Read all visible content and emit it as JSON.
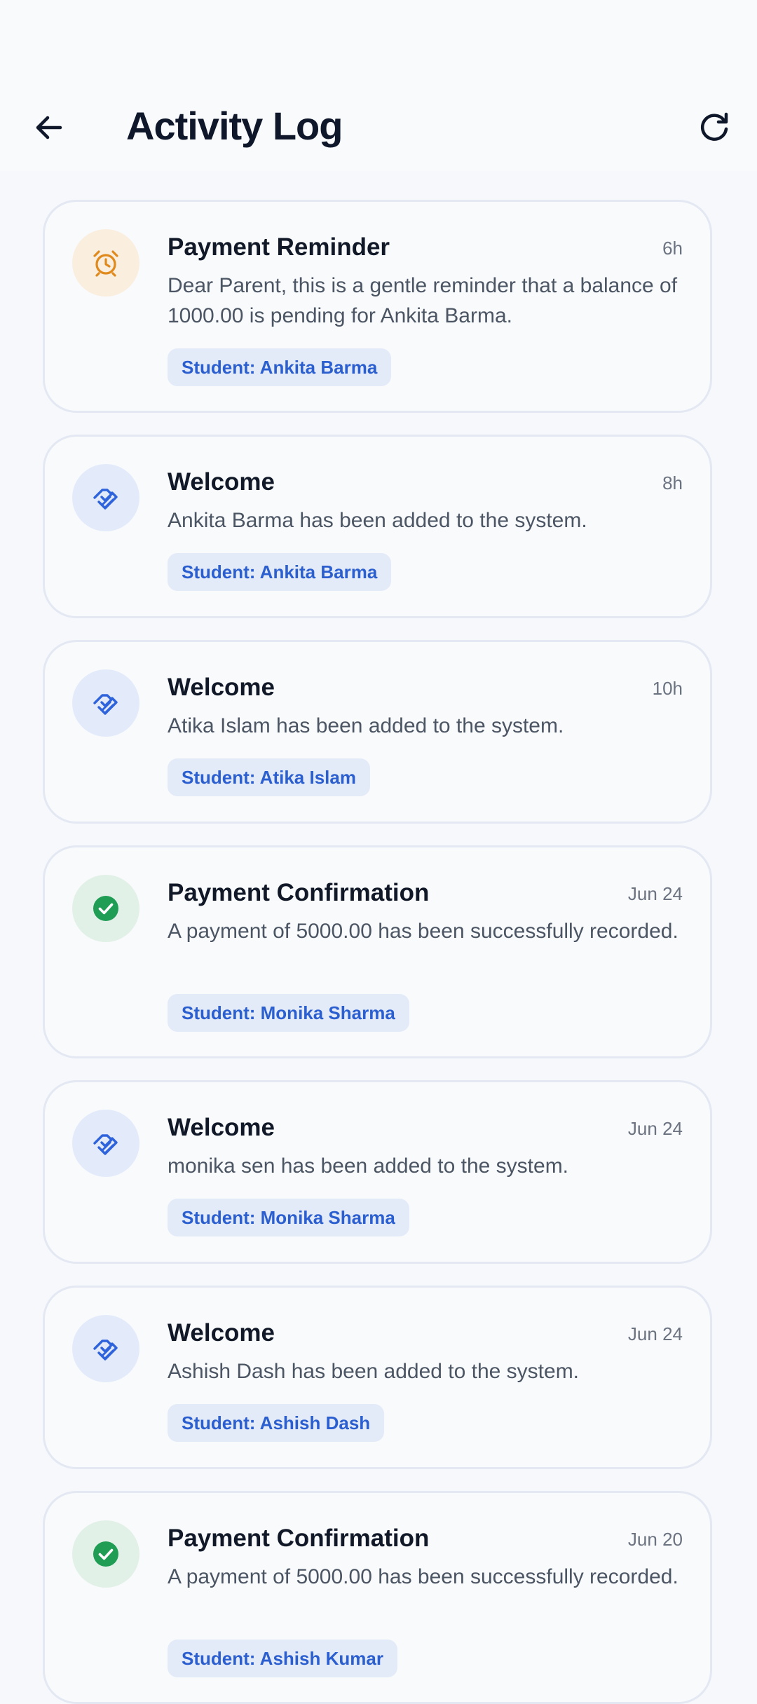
{
  "header": {
    "title": "Activity Log",
    "back_icon": "arrow-left-icon",
    "refresh_icon": "refresh-icon"
  },
  "colors": {
    "title": "#0f172a",
    "card_border": "#e3e8f2",
    "tag_bg": "#e4ebf8",
    "tag_text": "#2b5fd0",
    "reminder_accent": "#e08a1e",
    "welcome_accent": "#2f63dc",
    "confirm_accent": "#1f9d55"
  },
  "activities": [
    {
      "type": "reminder",
      "icon": "alarm-clock-icon",
      "title": "Payment Reminder",
      "time": "6h",
      "message": "Dear Parent, this is a gentle reminder that a balance of 1000.00 is pending for Ankita Barma.",
      "tag": "Student: Ankita Barma"
    },
    {
      "type": "welcome",
      "icon": "handshake-icon",
      "title": "Welcome",
      "time": "8h",
      "message": "Ankita Barma has been added to the system.",
      "tag": "Student: Ankita Barma"
    },
    {
      "type": "welcome",
      "icon": "handshake-icon",
      "title": "Welcome",
      "time": "10h",
      "message": "Atika Islam has been added to the system.",
      "tag": "Student: Atika Islam"
    },
    {
      "type": "confirmation",
      "icon": "check-circle-icon",
      "title": "Payment Confirmation",
      "time": "Jun 24",
      "message": "A payment of 5000.00 has been successfully recorded.",
      "tag": "Student: Monika Sharma"
    },
    {
      "type": "welcome",
      "icon": "handshake-icon",
      "title": "Welcome",
      "time": "Jun 24",
      "message": "monika sen has been added to the system.",
      "tag": "Student: Monika Sharma"
    },
    {
      "type": "welcome",
      "icon": "handshake-icon",
      "title": "Welcome",
      "time": "Jun 24",
      "message": "Ashish Dash has been added to the system.",
      "tag": "Student: Ashish Dash"
    },
    {
      "type": "confirmation",
      "icon": "check-circle-icon",
      "title": "Payment Confirmation",
      "time": "Jun 20",
      "message": "A payment of 5000.00 has been successfully recorded.",
      "tag": "Student: Ashish Kumar"
    }
  ]
}
